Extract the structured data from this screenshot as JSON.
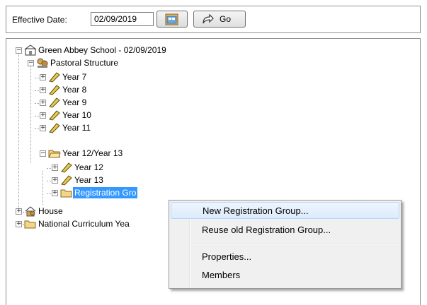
{
  "toolbar": {
    "effective_date_label": "Effective Date:",
    "effective_date_value": "02/09/2019",
    "go_label": "Go"
  },
  "tree": {
    "root": "Green Abbey School - 02/09/2019",
    "pastoral": "Pastoral Structure",
    "years": [
      "Year  7",
      "Year  8",
      "Year  9",
      "Year 10",
      "Year 11"
    ],
    "year12_13": "Year 12/Year 13",
    "year12": "Year 12",
    "year13": "Year 13",
    "reg_group": "Registration Gro",
    "house": "House",
    "national": "National Curriculum Yea"
  },
  "context_menu": {
    "items": [
      "New Registration Group...",
      "Reuse old Registration Group...",
      "Properties...",
      "Members"
    ]
  },
  "colors": {
    "selection": "#3399ff",
    "menu_hover": "#dcebfc"
  }
}
